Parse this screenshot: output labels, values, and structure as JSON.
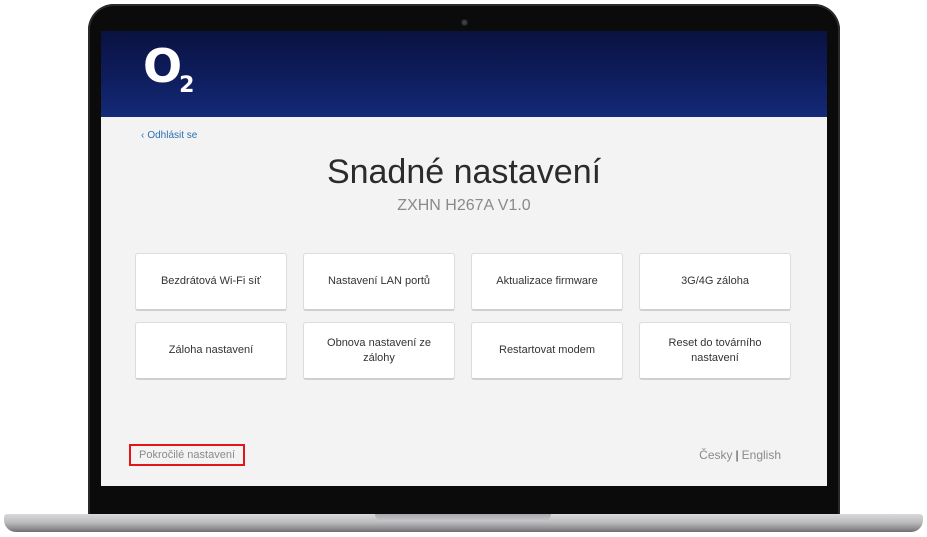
{
  "brand": {
    "logo_main": "O",
    "logo_sub": "2"
  },
  "nav": {
    "logout_chevron": "‹",
    "logout_label": "Odhlásit se"
  },
  "page": {
    "title": "Snadné nastavení",
    "subtitle": "ZXHN H267A V1.0"
  },
  "tiles": [
    {
      "label": "Bezdrátová Wi-Fi síť"
    },
    {
      "label": "Nastavení LAN portů"
    },
    {
      "label": "Aktualizace firmware"
    },
    {
      "label": "3G/4G záloha"
    },
    {
      "label": "Záloha nastavení"
    },
    {
      "label": "Obnova nastavení ze zálohy"
    },
    {
      "label": "Restartovat modem"
    },
    {
      "label": "Reset do továrního nastavení"
    }
  ],
  "footer": {
    "advanced_label": "Pokročilé nastavení",
    "lang_cs": "Česky",
    "lang_separator": "|",
    "lang_en": "English"
  },
  "colors": {
    "header_dark": "#0a1240",
    "header_light": "#142a77",
    "link_blue": "#2a6fb7",
    "highlight_red": "#e4141b"
  }
}
